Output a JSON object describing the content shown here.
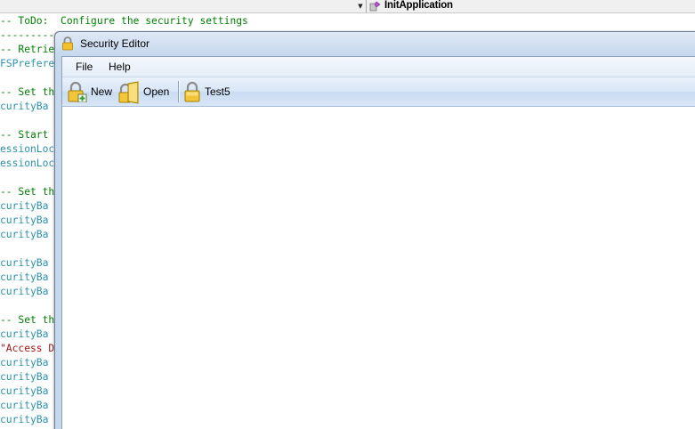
{
  "ide": {
    "method_name": "InitApplication",
    "first_line_comment": "-- ToDo:  Configure the security settings",
    "code_lines": [
      {
        "text": "----------",
        "kind": "comment"
      },
      {
        "text": "-- Retrie",
        "kind": "comment"
      },
      {
        "text": "FSPrefere",
        "kind": "ident"
      },
      {
        "text": "",
        "kind": "comment"
      },
      {
        "text": "-- Set th",
        "kind": "comment"
      },
      {
        "text": "curityBa",
        "kind": "ident"
      },
      {
        "text": "",
        "kind": "comment"
      },
      {
        "text": "-- Start ",
        "kind": "comment"
      },
      {
        "text": "essionLoc",
        "kind": "ident"
      },
      {
        "text": "essionLoc",
        "kind": "ident"
      },
      {
        "text": "",
        "kind": "comment"
      },
      {
        "text": "-- Set th",
        "kind": "comment"
      },
      {
        "text": "curityBa",
        "kind": "ident"
      },
      {
        "text": "curityBa",
        "kind": "ident"
      },
      {
        "text": "curityBa",
        "kind": "ident"
      },
      {
        "text": "",
        "kind": "comment"
      },
      {
        "text": "curityBa",
        "kind": "ident"
      },
      {
        "text": "curityBa",
        "kind": "ident"
      },
      {
        "text": "curityBa",
        "kind": "ident"
      },
      {
        "text": "",
        "kind": "comment"
      },
      {
        "text": "-- Set th",
        "kind": "comment"
      },
      {
        "text": "curityBa",
        "kind": "ident"
      },
      {
        "text": "\"Access D",
        "kind": "string"
      },
      {
        "text": "curityBa",
        "kind": "ident"
      },
      {
        "text": "curityBa",
        "kind": "ident"
      },
      {
        "text": "curityBa",
        "kind": "ident"
      },
      {
        "text": "curityBa",
        "kind": "ident"
      },
      {
        "text": "curityBa",
        "kind": "ident"
      }
    ],
    "colors": {
      "comment": "#008000",
      "ident": "#2b91af",
      "string": "#a31515"
    }
  },
  "window": {
    "title": "Security Editor",
    "icon": "padlock-icon",
    "menu": [
      {
        "label": "File"
      },
      {
        "label": "Help"
      }
    ],
    "toolbar": {
      "new_label": "New",
      "open_label": "Open",
      "test_label": "Test5",
      "icons": [
        "new-lock-icon",
        "open-lock-icon",
        "padlock-icon"
      ]
    },
    "colors": {
      "frame": "#c5d8ec",
      "toolbar": "#d7e5f6"
    }
  }
}
